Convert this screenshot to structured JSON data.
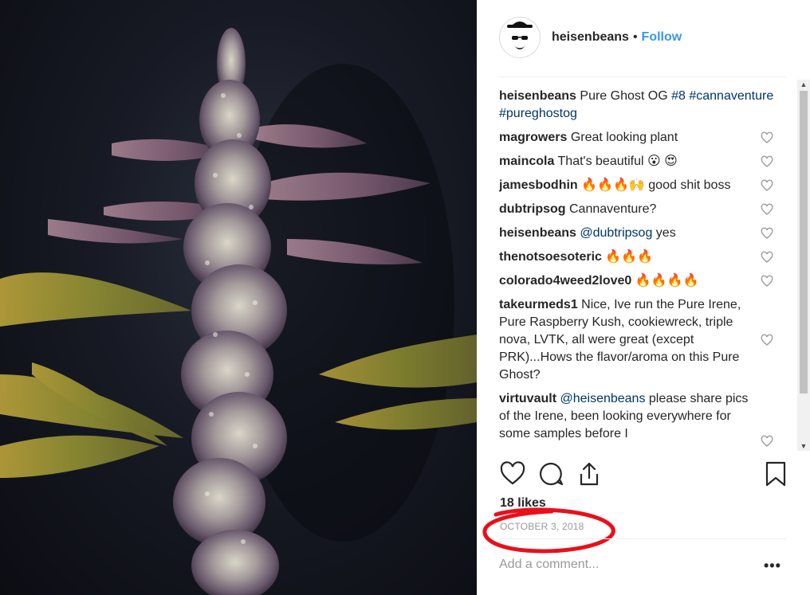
{
  "post": {
    "username": "heisenbeans",
    "separator": "•",
    "follow_label": "Follow",
    "likes": "18 likes",
    "date": "OCTOBER 3, 2018",
    "add_comment_placeholder": "Add a comment...",
    "more_label": "•••"
  },
  "caption": {
    "user": "heisenbeans",
    "text": "Pure Ghost OG ",
    "tags": "#8 #cannaventure #pureghostog"
  },
  "comments": [
    {
      "user": "magrowers",
      "text": "Great looking plant"
    },
    {
      "user": "maincola",
      "text": "That's beautiful 😮 😍"
    },
    {
      "user": "jamesbodhin",
      "text": "🔥🔥🔥🙌 good shit boss"
    },
    {
      "user": "dubtripsog",
      "text": "Cannaventure?"
    },
    {
      "user": "heisenbeans",
      "mention": "@dubtripsog",
      "text": " yes"
    },
    {
      "user": "thenotsoesoteric",
      "text": "🔥🔥🔥"
    },
    {
      "user": "colorado4weed2love0",
      "text": "🔥🔥🔥🔥"
    },
    {
      "user": "takeurmeds1",
      "text": "Nice, Ive run the Pure Irene, Pure Raspberry Kush, cookiewreck, triple nova, LVTK, all were great (except PRK)...Hows the flavor/aroma on this Pure Ghost?"
    },
    {
      "user": "virtuvault",
      "mention": "@heisenbeans",
      "text": " please share pics of the Irene, been looking everywhere for some samples before I"
    }
  ],
  "scrollbar": {
    "up": "▲",
    "down": "▼"
  },
  "icons": {
    "like": "heart-icon",
    "comment": "comment-icon",
    "share": "share-icon",
    "save": "bookmark-icon"
  },
  "colors": {
    "link": "#3897f0",
    "hashtag": "#003569",
    "annotation": "#e8101a"
  }
}
